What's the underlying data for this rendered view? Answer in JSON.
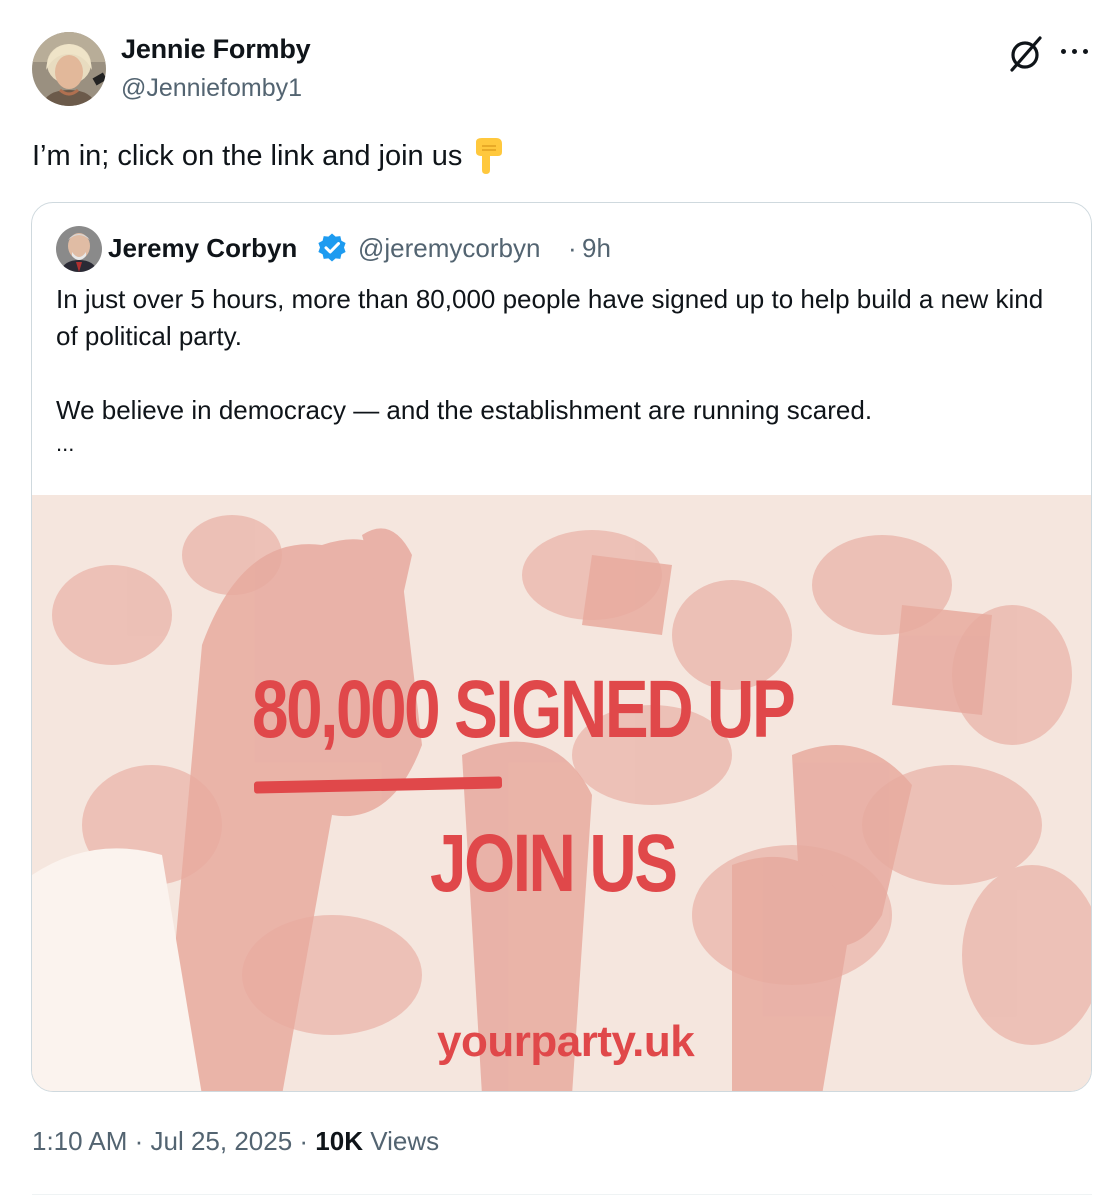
{
  "post": {
    "author": {
      "name": "Jennie Formby",
      "handle": "@Jenniefomby1"
    },
    "text": "I’m in; click on the link and join us",
    "emoji_icon": "backhand-index-pointing-down-icon",
    "timestamp": "1:10 AM · Jul 25, 2025 ·",
    "views_count": "10K",
    "views_label": "Views"
  },
  "quoted_post": {
    "author": {
      "name": "Jeremy Corbyn",
      "handle": "@jeremycorbyn",
      "verified": true
    },
    "separator": "·",
    "age": "9h",
    "text_lines": [
      "In just over 5 hours, more than 80,000 people have signed up to help build a new kind of political party.",
      "We believe in democracy — and the establishment are running scared."
    ],
    "truncation": "...",
    "image": {
      "headline": "80,000 SIGNED UP",
      "cta": "JOIN US",
      "url": "yourparty.uk",
      "accent_color": "#e0484a"
    }
  },
  "colors": {
    "text": "#0f1419",
    "secondary": "#536471",
    "verified": "#1d9bf0",
    "border": "#cfd9de"
  }
}
